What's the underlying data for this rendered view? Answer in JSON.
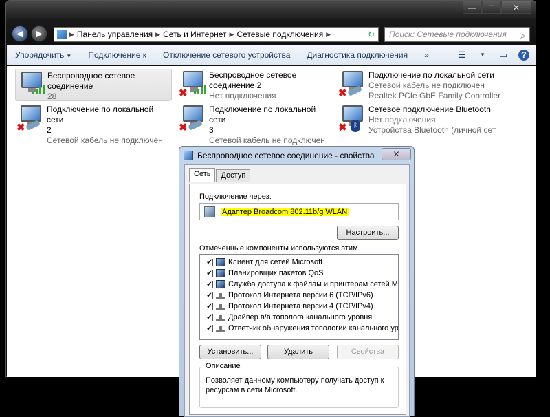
{
  "window": {
    "caption_buttons": [
      "—",
      "□",
      "✕"
    ]
  },
  "nav": {
    "back_icon": "back-arrow-icon",
    "forward_icon": "forward-arrow-icon",
    "breadcrumbs": [
      "Панель управления",
      "Сеть и Интернет",
      "Сетевые подключения"
    ],
    "search_placeholder": "Поиск: Сетевые подключения"
  },
  "toolbar": {
    "organize": "Упорядочить",
    "connect": "Подключение к",
    "disable": "Отключение сетевого устройства",
    "diagnose": "Диагностика подключения",
    "more": "»"
  },
  "connections": [
    {
      "name_line1": "Беспроводное сетевое",
      "name_line2": "соединение",
      "status": "28",
      "type": "wireless"
    },
    {
      "name_line1": "Беспроводное сетевое",
      "name_line2": "соединение 2",
      "status": "Нет подключения",
      "type": "wireless-off"
    },
    {
      "name_line1": "Подключение по локальной сети",
      "name_line2": "",
      "status": "Сетевой кабель не подключен",
      "status2": "Realtek PCIe GbE Family Controller",
      "type": "lan-off"
    },
    {
      "name_line1": "Подключение по локальной сети",
      "name_line2": "2",
      "status": "Сетевой кабель не подключен",
      "type": "lan-off"
    },
    {
      "name_line1": "Подключение по локальной сети",
      "name_line2": "3",
      "status": "Сетевой кабель не подключен",
      "type": "lan-off"
    },
    {
      "name_line1": "Сетевое подключение Bluetooth",
      "name_line2": "",
      "status": "Нет подключения",
      "status2": "Устройства Bluetooth (личной сет",
      "type": "bluetooth"
    }
  ],
  "dialog": {
    "title": "Беспроводное сетевое соединение - свойства",
    "close": "✕",
    "tabs": [
      "Сеть",
      "Доступ"
    ],
    "connect_using_label": "Подключение через:",
    "adapter": "Адаптер Broadcom 802.11b/g WLAN",
    "configure": "Настроить...",
    "components_label": "Отмеченные компоненты используются этим подключением:",
    "components": [
      {
        "label": "Клиент для сетей Microsoft",
        "checked": true,
        "icon": "network"
      },
      {
        "label": "Планировщик пакетов QoS",
        "checked": true,
        "icon": "network"
      },
      {
        "label": "Служба доступа к файлам и принтерам сетей Micro...",
        "checked": true,
        "icon": "network"
      },
      {
        "label": "Протокол Интернета версии 6 (TCP/IPv6)",
        "checked": true,
        "icon": "protocol"
      },
      {
        "label": "Протокол Интернета версии 4 (TCP/IPv4)",
        "checked": true,
        "icon": "protocol"
      },
      {
        "label": "Драйвер в/в тополога канального уровня",
        "checked": true,
        "icon": "protocol"
      },
      {
        "label": "Ответчик обнаружения топологии канального уровня",
        "checked": true,
        "icon": "protocol"
      }
    ],
    "install": "Установить...",
    "uninstall": "Удалить",
    "properties": "Свойства",
    "description_legend": "Описание",
    "description": "Позволяет данному компьютеру получать доступ к ресурсам в сети Microsoft."
  }
}
